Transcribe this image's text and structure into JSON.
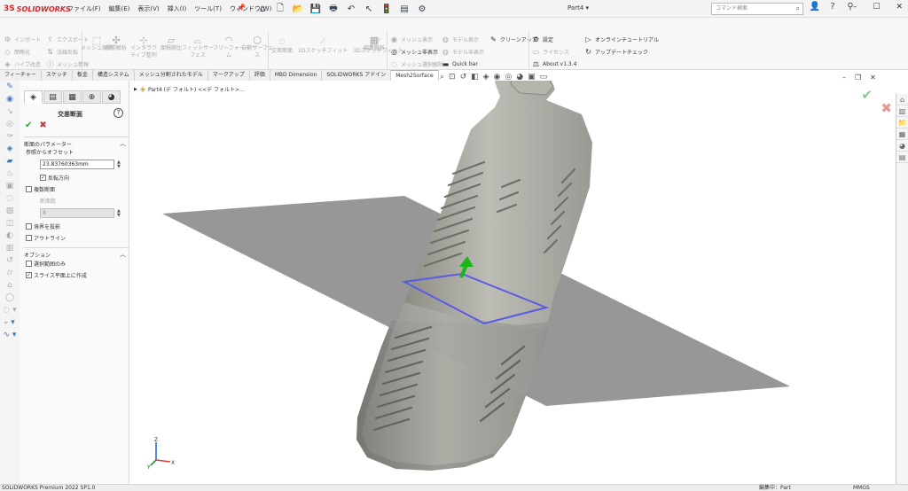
{
  "app": {
    "logo_ds": "3S",
    "logo_text": "SOLIDWORKS",
    "document_title": "Part4 ▾"
  },
  "menu": [
    "ファイル(F)",
    "編集(E)",
    "表示(V)",
    "挿入(I)",
    "ツール(T)",
    "ウィンドウ(W)"
  ],
  "search": {
    "placeholder": "コマンド検索"
  },
  "command_manager": {
    "col1": [
      "インポート",
      "簡略化",
      "ハイブ改造"
    ],
    "col2": [
      "エクスポート",
      "法線反転",
      "メッシュ情報"
    ],
    "big_buttons": [
      "メッシュ展開",
      "参照解析",
      "インタラクティブ整列",
      "面積剛比",
      "フィットサーフェス",
      "フリーフォーム",
      "自動サーフェス"
    ],
    "big_sub": [
      "",
      "列",
      "列",
      "比",
      "",
      "",
      ""
    ],
    "col3": [
      "交差断面",
      "2Dスケッチフィット",
      "3Dスケッチフィット"
    ],
    "big_edit": "編集解析",
    "col4": [
      "メッシュ表示",
      "メッシュ非表示",
      "メッシュ選択解除"
    ],
    "col5": [
      "モデル表示",
      "モデル非表示",
      "Quick bar"
    ],
    "cleanup": "クリーンアップ",
    "col6": [
      "設定",
      "ライセンス",
      "About v1.3.4"
    ],
    "col7": [
      "オンラインチュートリアル",
      "アップデートチェック"
    ]
  },
  "tabs": [
    "フィーチャー",
    "スケッチ",
    "板金",
    "構造システム",
    "メッシュ分割されたモデル",
    "マークアップ",
    "評価",
    "MBD Dimension",
    "SOLIDWORKS アドイン",
    "Mesh2Surface"
  ],
  "active_tab": "Mesh2Surface",
  "property_manager": {
    "title": "交差断面",
    "section_params": "断面のパラメーター",
    "offset_label": "参照からオフセット",
    "offset_value": "23.83760363mm",
    "reverse": "反転方向",
    "multi": "複数断面",
    "count_label": "断面数",
    "count_value": "8",
    "project": "境界を投影",
    "outline": "アウトライン",
    "options": "オプション",
    "selected_only": "選択範囲のみ",
    "create_on_plane": "スライス平面上に作成"
  },
  "feature_tree": {
    "root": "Part4 (デ フォルト) <<デ フォルト>..."
  },
  "status": {
    "product": "SOLIDWORKS Premium 2022 SP1.0",
    "mode": "編集中：Part",
    "units": "MMGS"
  },
  "colors": {
    "accent": "#4478b6",
    "plane": "#8e8e8e",
    "section_curve": "#5a5ae6",
    "arrow": "#18b618",
    "bottle": "#a8a8a2"
  }
}
